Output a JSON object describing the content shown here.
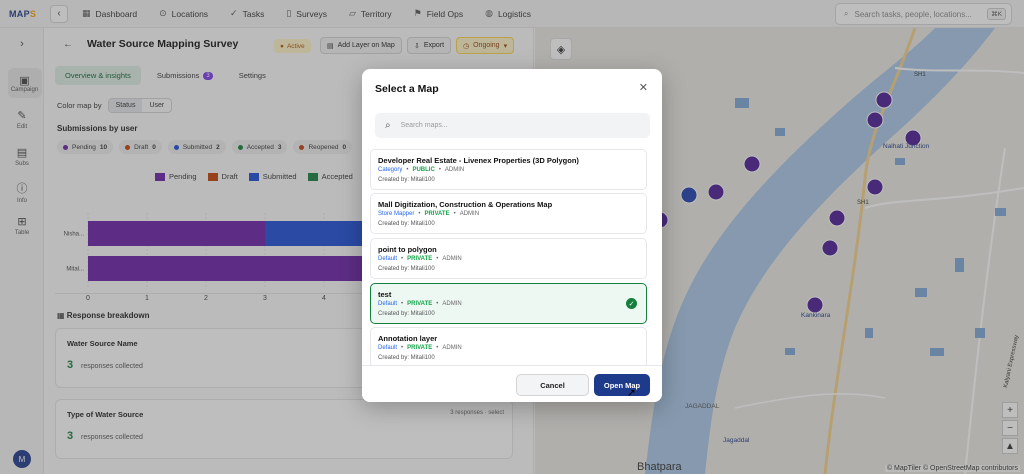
{
  "app": {
    "logo_a": "MAP",
    "logo_b": "S"
  },
  "nav": {
    "items": [
      {
        "label": "Dashboard",
        "icon": "dashboard-icon"
      },
      {
        "label": "Locations",
        "icon": "pin-icon"
      },
      {
        "label": "Tasks",
        "icon": "check-icon"
      },
      {
        "label": "Surveys",
        "icon": "clipboard-icon"
      },
      {
        "label": "Territory",
        "icon": "map-icon"
      },
      {
        "label": "Field Ops",
        "icon": "flag-icon"
      },
      {
        "label": "Logistics",
        "icon": "globe-icon"
      }
    ],
    "search_placeholder": "Search tasks, people, locations...",
    "search_shortcut": "⌘K"
  },
  "rail": {
    "items": [
      {
        "label": "Campaign"
      },
      {
        "label": "Edit"
      },
      {
        "label": "Subs"
      },
      {
        "label": "Info"
      },
      {
        "label": "Table"
      }
    ],
    "avatar": "M"
  },
  "survey": {
    "title": "Water Source Mapping Survey",
    "status": "Active",
    "add_layer": "Add Layer on Map",
    "export": "Export",
    "ongoing": "Ongoing",
    "tabs": [
      {
        "label": "Overview & insights"
      },
      {
        "label": "Submissions",
        "count": "3"
      },
      {
        "label": "Settings"
      }
    ],
    "color_map_by": "Color map by",
    "color_options": [
      "Status",
      "User"
    ],
    "submissions_by_user": "Submissions by user",
    "pills": [
      {
        "label": "Pending",
        "count": "10",
        "color": "#6b21a8"
      },
      {
        "label": "Draft",
        "count": "0",
        "color": "#c2410c"
      },
      {
        "label": "Submitted",
        "count": "2",
        "color": "#1d4ed8"
      },
      {
        "label": "Accepted",
        "count": "3",
        "color": "#15803d"
      },
      {
        "label": "Reopened",
        "count": "0",
        "color": "#c2410c"
      }
    ],
    "response_breakdown": "Response breakdown",
    "cards": [
      {
        "question": "Water Source Name",
        "count": "3",
        "label": "responses collected",
        "right": ""
      },
      {
        "question": "Type of Water Source",
        "count": "3",
        "label": "responses collected",
        "right": "3 responses · select"
      }
    ]
  },
  "chart_data": {
    "type": "bar",
    "orientation": "horizontal",
    "stacked": true,
    "categories": [
      "Nisha...",
      "Mital..."
    ],
    "series": [
      {
        "name": "Pending",
        "color": "#6b21a8",
        "values": [
          3,
          5
        ]
      },
      {
        "name": "Draft",
        "color": "#c2410c",
        "values": [
          0,
          0
        ]
      },
      {
        "name": "Submitted",
        "color": "#1d4ed8",
        "values": [
          2,
          0
        ]
      },
      {
        "name": "Accepted",
        "color": "#15803d",
        "values": [
          0,
          0
        ]
      },
      {
        "name": "Reopened",
        "color": "#c2410c",
        "values": [
          0,
          0
        ]
      }
    ],
    "xticks": [
      "0",
      "1",
      "2",
      "3",
      "4"
    ],
    "xlim": [
      0,
      5
    ]
  },
  "map": {
    "labels": [
      "Nalhati Junction",
      "Kankinara",
      "JAGADDAL",
      "Jagaddal",
      "Bhatpara",
      "SH1",
      "SH1",
      "Kalyani Expressway",
      "AH"
    ],
    "attribution": "© MapTiler © OpenStreetMap contributors"
  },
  "modal": {
    "title": "Select a Map",
    "search_placeholder": "Search maps...",
    "items": [
      {
        "name": "Developer Real Estate - Livenex Properties (3D Polygon)",
        "category": "Category",
        "visibility": "PUBLIC",
        "role": "ADMIN",
        "created_by": "Created by: Mitali100",
        "selected": false
      },
      {
        "name": "Mall Digitization, Construction & Operations Map",
        "category": "Store Mapper",
        "visibility": "PRIVATE",
        "role": "ADMIN",
        "created_by": "Created by: Mitali100",
        "selected": false
      },
      {
        "name": "point to polygon",
        "category": "Default",
        "visibility": "PRIVATE",
        "role": "ADMIN",
        "created_by": "Created by: Mitali100",
        "selected": false
      },
      {
        "name": "test",
        "category": "Default",
        "visibility": "PRIVATE",
        "role": "ADMIN",
        "created_by": "Created by: Mitali100",
        "selected": true
      },
      {
        "name": "Annotation layer",
        "category": "Default",
        "visibility": "PRIVATE",
        "role": "ADMIN",
        "created_by": "Created by: Mitali100",
        "selected": false
      }
    ],
    "cancel": "Cancel",
    "open": "Open Map"
  }
}
